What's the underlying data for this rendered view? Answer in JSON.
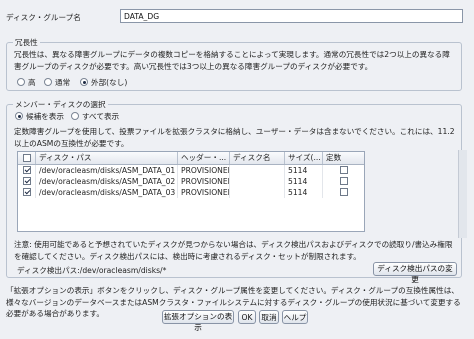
{
  "diskgroup": {
    "label": "ディスク・グループ名",
    "value": "DATA_DG"
  },
  "redundancy": {
    "title": "冗長性",
    "description": "冗長性は、異なる障害グループにデータの複数コピーを格納することによって実現します。通常の冗長性では2つ以上の異なる障害グループのディスクが必要です。高い冗長性では3つ以上の異なる障害グループのディスクが必要です。",
    "options": [
      {
        "label": "高",
        "selected": false
      },
      {
        "label": "通常",
        "selected": false
      },
      {
        "label": "外部(なし)",
        "selected": true
      }
    ]
  },
  "members": {
    "title": "メンバー・ディスクの選択",
    "filter_options": [
      {
        "label": "候補を表示",
        "selected": true
      },
      {
        "label": "すべて表示",
        "selected": false
      }
    ],
    "info": "定数障害グループを使用して、投票ファイルを拡張クラスタに格納し、ユーザー・データは含まないでください。これには、11.2以上のASMの互換性が必要です。",
    "columns": [
      "",
      "ディスク・パス",
      "ヘッダー・...",
      "ディスク名",
      "サイズ(...",
      "定数"
    ],
    "rows": [
      {
        "selected": true,
        "path": "/dev/oracleasm/disks/ASM_DATA_01",
        "header": "PROVISIONED",
        "name": "",
        "size": "5114",
        "quorum": false
      },
      {
        "selected": true,
        "path": "/dev/oracleasm/disks/ASM_DATA_02",
        "header": "PROVISIONED",
        "name": "",
        "size": "5114",
        "quorum": false
      },
      {
        "selected": true,
        "path": "/dev/oracleasm/disks/ASM_DATA_03",
        "header": "PROVISIONED",
        "name": "",
        "size": "5114",
        "quorum": false
      }
    ],
    "note": "注意: 使用可能であると予想されていたディスクが見つからない場合は、ディスク検出パスおよびディスクでの読取り/書込み権限を確認してください。ディスク検出パスには、検出時に考慮されるディスク・セットが制限されます。",
    "discovery_path": "ディスク検出パス:/dev/oracleasm/disks/*",
    "change_discovery_button": "ディスク検出パスの変更"
  },
  "advanced_note": "「拡張オプションの表示」ボタンをクリックし、ディスク・グループ属性を変更してください。ディスク・グループの互換性属性は、様々なバージョンのデータベースまたはASMクラスタ・ファイルシステムに対するディスク・グループの使用状況に基づいて変更する必要がある場合があります。",
  "buttons": {
    "advanced": "拡張オプションの表示",
    "ok": "OK",
    "cancel": "取消",
    "help": "ヘルプ"
  }
}
